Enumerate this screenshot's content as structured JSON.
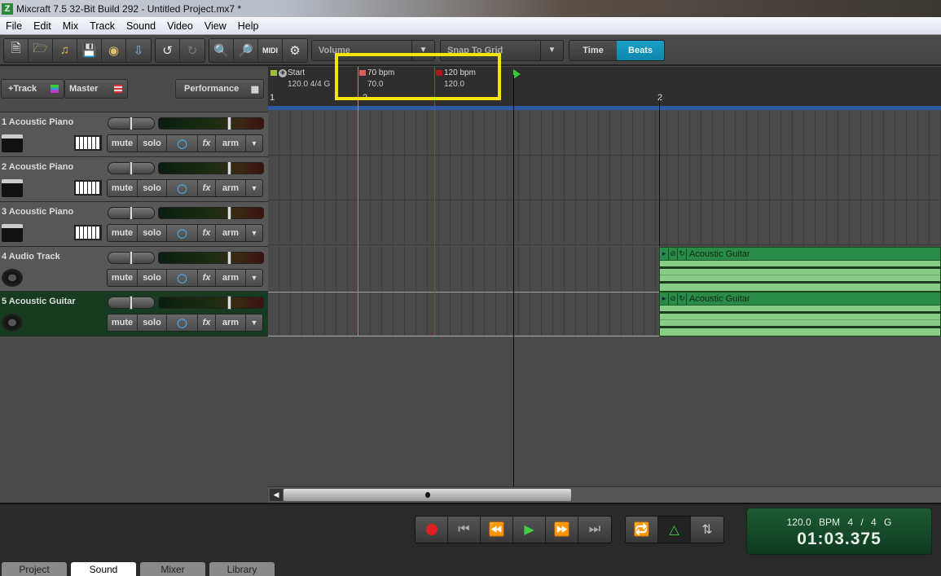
{
  "window": {
    "title": "Mixcraft 7.5 32-Bit Build 292 - Untitled Project.mx7 *",
    "app_icon": "Z"
  },
  "menu": [
    "File",
    "Edit",
    "Mix",
    "Track",
    "Sound",
    "Video",
    "View",
    "Help"
  ],
  "toolbar": {
    "icons": [
      "new-file-icon",
      "open-folder-icon",
      "open-music-folder-icon",
      "save-icon",
      "burn-cd-icon",
      "import-audio-icon",
      "undo-icon",
      "redo-icon",
      "zoom-in-icon",
      "zoom-out-icon",
      "midi-icon",
      "settings-gear-icon"
    ],
    "automation_dropdown": "Volume",
    "snap_dropdown": "Snap To Grid",
    "time_label": "Time",
    "beats_label": "Beats",
    "active_mode": "Beats"
  },
  "panel": {
    "add_track": "+Track",
    "master": "Master",
    "performance": "Performance"
  },
  "tracks": [
    {
      "name": "1 Acoustic Piano",
      "type": "midi",
      "buttons": [
        "mute",
        "solo",
        "fx",
        "arm"
      ]
    },
    {
      "name": "2 Acoustic Piano",
      "type": "midi",
      "buttons": [
        "mute",
        "solo",
        "fx",
        "arm"
      ]
    },
    {
      "name": "3 Acoustic Piano",
      "type": "midi",
      "buttons": [
        "mute",
        "solo",
        "fx",
        "arm"
      ]
    },
    {
      "name": "4 Audio Track",
      "type": "audio",
      "buttons": [
        "mute",
        "solo",
        "fx",
        "arm"
      ]
    },
    {
      "name": "5 Acoustic Guitar",
      "type": "audio",
      "selected": true,
      "buttons": [
        "mute",
        "solo",
        "fx",
        "arm"
      ]
    }
  ],
  "ruler": {
    "markers": [
      {
        "title": "Start",
        "sub": "120.0 4/4 G",
        "flag_color": "#9bbf3a"
      },
      {
        "title": "70 bpm",
        "sub": "70.0",
        "flag_color": "#e05a5a"
      },
      {
        "title": "120 bpm",
        "sub": "120.0",
        "flag_color": "#b01818"
      }
    ],
    "bar_numbers": [
      "1",
      "2",
      "2"
    ]
  },
  "clips": [
    {
      "track": 4,
      "name": "Acoustic Guitar"
    },
    {
      "track": 5,
      "name": "Acoustic Guitar"
    }
  ],
  "transport": {
    "buttons": [
      "record",
      "go-to-start",
      "rewind",
      "play",
      "fast-forward",
      "go-to-end"
    ],
    "extra": [
      "loop",
      "metronome",
      "mixdown"
    ]
  },
  "display": {
    "bpm": "120.0 BPM",
    "signature": "4 / 4",
    "key": "G",
    "time": "01:03.375"
  },
  "tabs": [
    "Project",
    "Sound",
    "Mixer",
    "Library"
  ],
  "active_tab": "Sound"
}
